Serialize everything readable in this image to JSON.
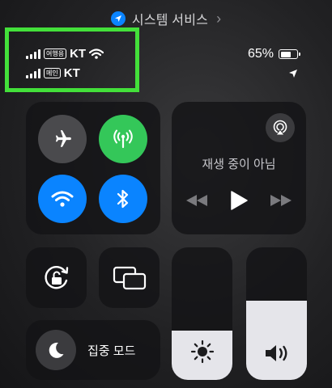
{
  "top_bar": {
    "label": "시스템 서비스",
    "icon": "location-badge-icon"
  },
  "status": {
    "sim1": {
      "tag": "여행용",
      "carrier": "KT",
      "wifi": true
    },
    "sim2": {
      "tag": "메인",
      "carrier": "KT"
    },
    "battery_pct": "65%",
    "battery_level": 0.65,
    "location_active": true
  },
  "connectivity": {
    "airplane": {
      "on": false,
      "icon": "airplane-icon"
    },
    "cellular": {
      "on": true,
      "icon": "cellular-antenna-icon"
    },
    "wifi": {
      "on": true,
      "icon": "wifi-icon"
    },
    "bluetooth": {
      "on": true,
      "icon": "bluetooth-icon"
    }
  },
  "media": {
    "status": "재생 중이 아님",
    "airplay_icon": "airplay-audio-icon"
  },
  "focus": {
    "label": "집중 모드",
    "icon": "moon-icon"
  },
  "brightness": {
    "level": 0.37,
    "icon": "sun-icon"
  },
  "volume": {
    "level": 0.6,
    "icon": "speaker-icon"
  },
  "colors": {
    "highlight_box": "#43e03a",
    "active_green": "#34c759",
    "active_blue": "#0a84ff"
  }
}
